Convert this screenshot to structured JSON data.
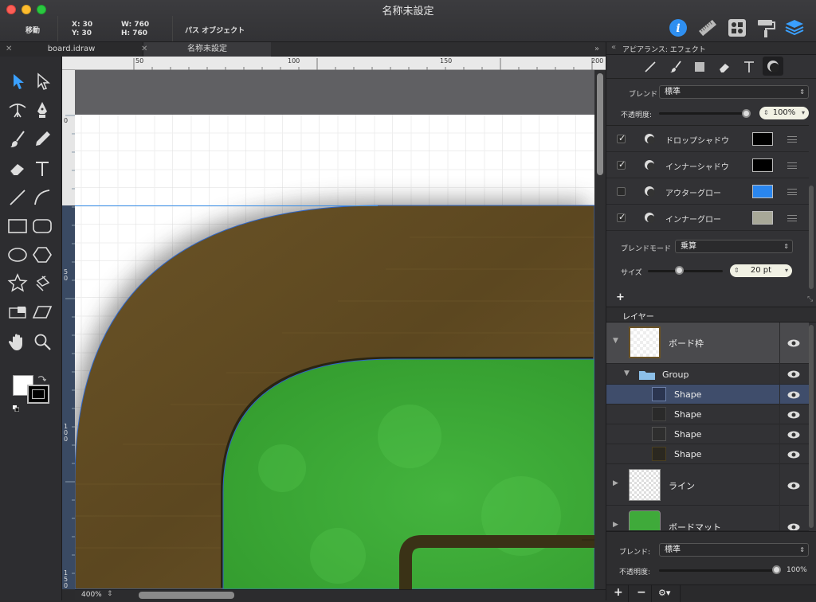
{
  "window": {
    "title": "名称未設定"
  },
  "toolbar": {
    "move_label": "移動",
    "x": "X:  30",
    "y": "Y:  30",
    "w": "W:  760",
    "h": "H:  760",
    "object_label": "パス オブジェクト"
  },
  "tabs": [
    {
      "label": "board.idraw"
    },
    {
      "label": "名称未設定"
    }
  ],
  "ruler": {
    "h_ticks": [
      "50",
      "100",
      "150",
      "200"
    ],
    "v_ticks": [
      "0",
      "5\n0",
      "1\n0\n0",
      "1\n5\n0"
    ]
  },
  "zoom": "400%",
  "appearance": {
    "header": "アピアランス:  エフェクト",
    "blend_label": "ブレンド",
    "blend_value": "標準",
    "opacity_label": "不透明度:",
    "opacity_value": "100%",
    "opacity_fraction": 1.0,
    "effects": [
      {
        "label": "ドロップシャドウ",
        "checked": true,
        "color": "#000000"
      },
      {
        "label": "インナーシャドウ",
        "checked": true,
        "color": "#000000"
      },
      {
        "label": "アウターグロー",
        "checked": false,
        "color": "#2a86ee"
      },
      {
        "label": "インナーグロー",
        "checked": true,
        "color": "#a8a898"
      }
    ],
    "blend_mode_label": "ブレンドモード",
    "blend_mode_value": "乗算",
    "size_label": "サイズ",
    "size_value": "20 pt",
    "add_label": "+"
  },
  "layers": {
    "header": "レイヤー",
    "items": [
      {
        "label": "ボード枠"
      },
      {
        "label": "Group"
      },
      {
        "label": "Shape"
      },
      {
        "label": "Shape"
      },
      {
        "label": "Shape"
      },
      {
        "label": "Shape"
      },
      {
        "label": "ライン"
      },
      {
        "label": "ボードマット"
      }
    ],
    "blend_label": "ブレンド:",
    "blend_value": "標準",
    "opacity_label": "不透明度:",
    "opacity_value": "100%",
    "add": "+",
    "remove": "−",
    "gear": "⚙▾"
  },
  "colors": {
    "accent": "#3a8ee6",
    "board_brown": "#6b5326",
    "mat_green": "#3faa3a"
  }
}
